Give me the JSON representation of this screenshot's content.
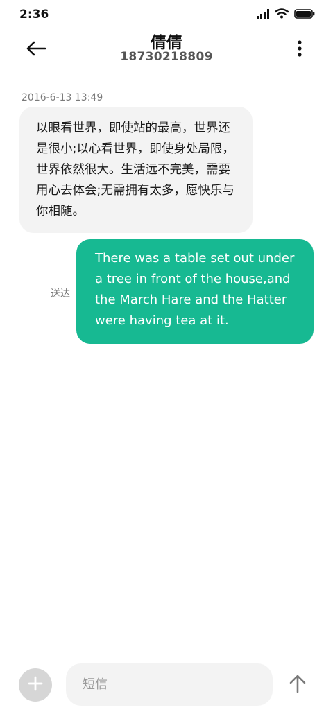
{
  "status_bar": {
    "time": "2:36",
    "icons": [
      "signal-icon",
      "wifi-icon",
      "battery-icon"
    ]
  },
  "header": {
    "contact_name": "倩倩",
    "contact_number": "18730218809",
    "icons": [
      "back-arrow-icon",
      "more-vertical-icon"
    ]
  },
  "conversation": {
    "timestamp": "2016-6-13 13:49",
    "incoming_message": "以眼看世界，即使站的最高，世界还是很小;以心看世界，即使身处局限，世界依然很大。生活远不完美，需要用心去体会;无需拥有太多，愿快乐与你相随。",
    "outgoing_message": "There was a table set out under a tree in front of the house,and the March Hare and the Hatter were having tea at it.",
    "delivery_status": "送达"
  },
  "compose": {
    "placeholder": "短信",
    "icons": [
      "plus-icon",
      "send-arrow-icon"
    ]
  },
  "colors": {
    "outgoing_bubble": "#17b992",
    "incoming_bubble": "#f3f3f3",
    "add_button": "#d6d6d6"
  }
}
